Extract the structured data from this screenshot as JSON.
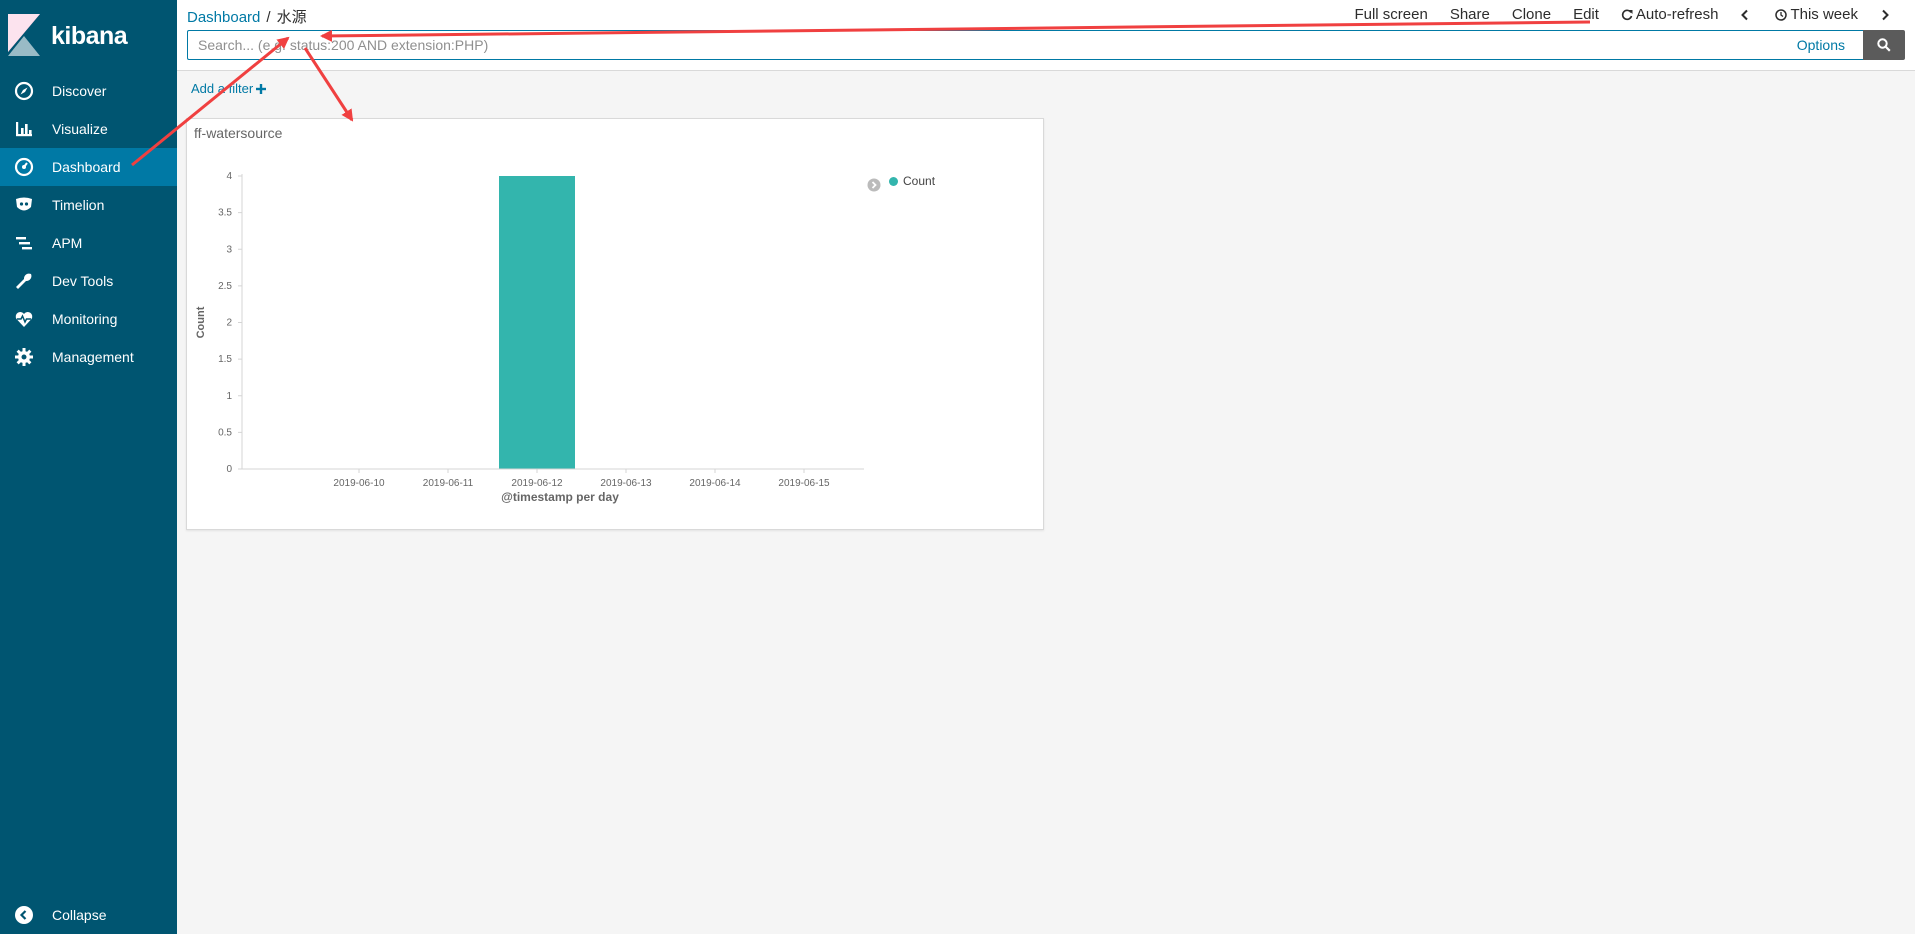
{
  "app": {
    "brand": "kibana"
  },
  "sidebar": {
    "items": [
      {
        "label": "Discover",
        "icon": "compass-icon",
        "active": false
      },
      {
        "label": "Visualize",
        "icon": "bar-chart-icon",
        "active": false
      },
      {
        "label": "Dashboard",
        "icon": "dashboard-icon",
        "active": true
      },
      {
        "label": "Timelion",
        "icon": "timelion-icon",
        "active": false
      },
      {
        "label": "APM",
        "icon": "apm-icon",
        "active": false
      },
      {
        "label": "Dev Tools",
        "icon": "wrench-icon",
        "active": false
      },
      {
        "label": "Monitoring",
        "icon": "heartbeat-icon",
        "active": false
      },
      {
        "label": "Management",
        "icon": "gear-icon",
        "active": false
      }
    ],
    "collapse_label": "Collapse"
  },
  "breadcrumb": {
    "parent": "Dashboard",
    "separator": "/",
    "current": "水源"
  },
  "top_menu": {
    "full_screen": "Full screen",
    "share": "Share",
    "clone": "Clone",
    "edit": "Edit",
    "auto_refresh": "Auto-refresh",
    "time_range": "This week"
  },
  "search": {
    "placeholder": "Search... (e.g. status:200 AND extension:PHP)",
    "value": "",
    "options_label": "Options"
  },
  "filter": {
    "add_label": "Add a filter"
  },
  "panel": {
    "title": "ff-watersource"
  },
  "colors": {
    "sidebar_bg": "#005571",
    "accent": "#0079a5",
    "series": "#33b5ad",
    "annotation_arrow": "#f04040"
  },
  "chart_data": {
    "type": "bar",
    "categories": [
      "2019-06-10",
      "2019-06-11",
      "2019-06-12",
      "2019-06-13",
      "2019-06-14",
      "2019-06-15"
    ],
    "series": [
      {
        "name": "Count",
        "values": [
          0,
          0,
          4,
          0,
          0,
          0
        ],
        "color": "#33b5ad"
      }
    ],
    "xlabel": "@timestamp per day",
    "ylabel": "Count",
    "ylim": [
      0,
      4
    ],
    "yticks": [
      "0",
      "0.5",
      "1",
      "1.5",
      "2",
      "2.5",
      "3",
      "3.5",
      "4"
    ],
    "legend_position": "top-right",
    "grid": false
  }
}
